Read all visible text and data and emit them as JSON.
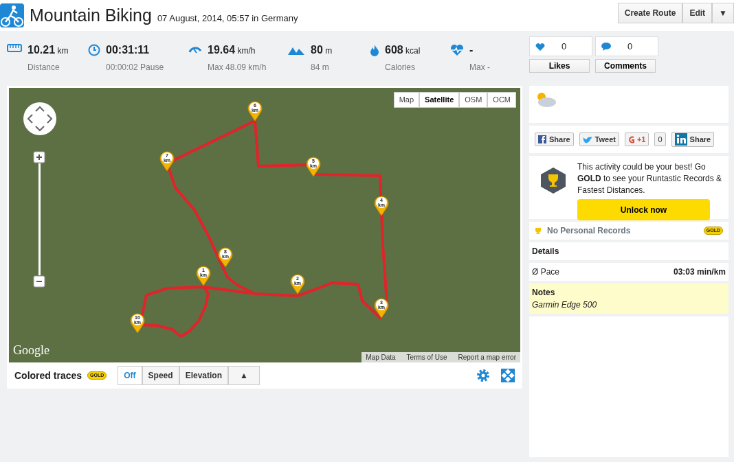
{
  "header": {
    "title": "Mountain Biking",
    "subtitle": "07 August, 2014, 05:57 in Germany",
    "buttons": [
      "Create Route",
      "Edit"
    ],
    "menu_caret": "▼"
  },
  "stats": [
    {
      "kind": "distance",
      "value": "10.21",
      "unit": "km",
      "label": "Distance"
    },
    {
      "kind": "duration",
      "value": "00:31:11",
      "label": "00:00:02 Pause"
    },
    {
      "kind": "speed",
      "value": "19.64",
      "unit": "km/h",
      "label": "Max 48.09 km/h"
    },
    {
      "kind": "elevation",
      "value": "80",
      "unit": "m",
      "label": "84 m"
    },
    {
      "kind": "calories",
      "value": "608",
      "unit": "kcal",
      "label": "Calories"
    },
    {
      "kind": "heartrate",
      "value": "-",
      "label": "Max -"
    }
  ],
  "social": [
    {
      "kind": "likes",
      "count": "0",
      "label": "Likes"
    },
    {
      "kind": "comments",
      "count": "0",
      "label": "Comments"
    }
  ],
  "map": {
    "types": [
      {
        "label": "Map",
        "selected": false
      },
      {
        "label": "Satellite",
        "selected": true
      },
      {
        "label": "OSM",
        "selected": false
      },
      {
        "label": "OCM",
        "selected": false
      }
    ],
    "markers": [
      {
        "number": "1",
        "unit": "km"
      },
      {
        "number": "2",
        "unit": "km"
      },
      {
        "number": "3",
        "unit": "km"
      },
      {
        "number": "4",
        "unit": "km"
      },
      {
        "number": "5",
        "unit": "km"
      },
      {
        "number": "6",
        "unit": "km"
      },
      {
        "number": "7",
        "unit": "km"
      },
      {
        "number": "8",
        "unit": "km"
      },
      {
        "number": "10",
        "unit": "km"
      }
    ],
    "logo": "Google",
    "footer_links": [
      "Map Data",
      "Terms of Use",
      "Report a map error"
    ]
  },
  "traces": {
    "label": "Colored traces",
    "badge": "GOLD",
    "options": [
      {
        "label": "Off",
        "selected": true
      },
      {
        "label": "Speed",
        "selected": false
      },
      {
        "label": "Elevation",
        "selected": false
      }
    ],
    "toggle": "▲"
  },
  "share": [
    {
      "kind": "facebook",
      "label": "Share"
    },
    {
      "kind": "twitter",
      "label": "Tweet"
    },
    {
      "kind": "gplus",
      "label": "+1",
      "count": "0"
    },
    {
      "kind": "linkedin",
      "label": "Share"
    }
  ],
  "promo": {
    "text": "This activity could be your best! Go **GOLD** to see your Runtastic Records & Fastest Distances.",
    "button": "Unlock now"
  },
  "records": {
    "label": "No Personal Records",
    "badge": "GOLD"
  },
  "details": {
    "title": "Details",
    "rows": [
      {
        "label": "Ø Pace",
        "value": "03:03 min/km"
      }
    ]
  },
  "notes": {
    "title": "Notes",
    "text": "Garmin Edge 500"
  }
}
